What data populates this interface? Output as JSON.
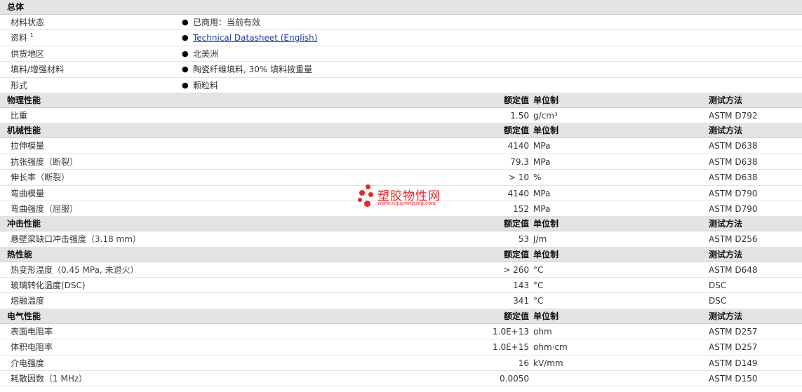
{
  "general": {
    "title": "总体",
    "rows": [
      {
        "label": "材料状态",
        "sup": "",
        "value": "已商用：当前有效"
      },
      {
        "label": "资料",
        "sup": "1",
        "value": "Technical Datasheet (English)"
      },
      {
        "label": "供货地区",
        "sup": "",
        "value": "北美洲"
      },
      {
        "label": "填料/增强材料",
        "sup": "",
        "value": "陶瓷纤维填料, 30% 填料按重量"
      },
      {
        "label": "形式",
        "sup": "",
        "value": "颗粒料"
      }
    ]
  },
  "col_headers": {
    "nominal": "额定值",
    "unit": "单位制",
    "test": "测试方法"
  },
  "sections": [
    {
      "title": "物理性能",
      "rows": [
        {
          "label": "比重",
          "cond": "",
          "value": "1.50",
          "unit": "g/cm³",
          "test": "ASTM D792"
        }
      ]
    },
    {
      "title": "机械性能",
      "rows": [
        {
          "label": "拉伸模量",
          "cond": "",
          "value": "4140",
          "unit": "MPa",
          "test": "ASTM D638"
        },
        {
          "label": "抗张强度",
          "cond": "（断裂）",
          "value": "79.3",
          "unit": "MPa",
          "test": "ASTM D638"
        },
        {
          "label": "伸长率",
          "cond": "（断裂）",
          "value": "> 10",
          "unit": "%",
          "test": "ASTM D638"
        },
        {
          "label": "弯曲模量",
          "cond": "",
          "value": "4140",
          "unit": "MPa",
          "test": "ASTM D790"
        },
        {
          "label": "弯曲强度",
          "cond": "（屈服）",
          "value": "152",
          "unit": "MPa",
          "test": "ASTM D790"
        }
      ]
    },
    {
      "title": "冲击性能",
      "rows": [
        {
          "label": "悬壁梁缺口冲击强度",
          "cond": "（3.18 mm）",
          "value": "53",
          "unit": "J/m",
          "test": "ASTM D256"
        }
      ]
    },
    {
      "title": "热性能",
      "rows": [
        {
          "label": "热变形温度",
          "cond": "（0.45 MPa, 未退火）",
          "value": "> 260",
          "unit": "°C",
          "test": "ASTM D648"
        },
        {
          "label": "玻璃转化温度(DSC)",
          "cond": "",
          "value": "143",
          "unit": "°C",
          "test": "DSC"
        },
        {
          "label": "熔融温度",
          "cond": "",
          "value": "341",
          "unit": "°C",
          "test": "DSC"
        }
      ]
    },
    {
      "title": "电气性能",
      "rows": [
        {
          "label": "表面电阻率",
          "cond": "",
          "value": "1.0E+13",
          "unit": "ohm",
          "test": "ASTM D257"
        },
        {
          "label": "体积电阻率",
          "cond": "",
          "value": "1.0E+15",
          "unit": "ohm·cm",
          "test": "ASTM D257"
        },
        {
          "label": "介电强度",
          "cond": "",
          "value": "16",
          "unit": "kV/mm",
          "test": "ASTM D149"
        },
        {
          "label": "耗散因数",
          "cond": "（1 MHz）",
          "value": "0.0050",
          "unit": "",
          "test": "ASTM D150"
        }
      ]
    }
  ],
  "watermark": {
    "name": "塑胶物性网",
    "url": "www.sujiaowuxing.com",
    "color": "#e8262b"
  }
}
